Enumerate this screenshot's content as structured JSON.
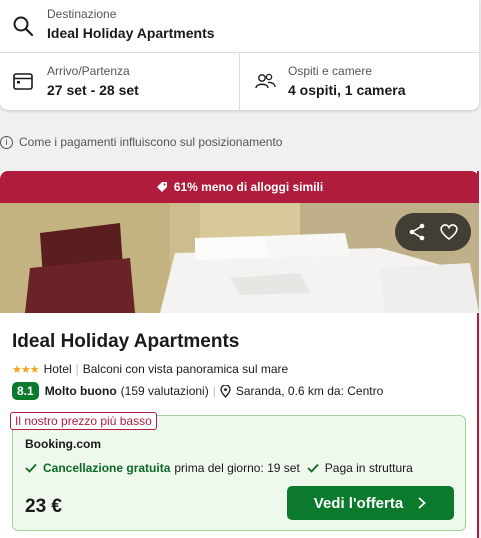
{
  "search": {
    "destination_label": "Destinazione",
    "destination_value": "Ideal Holiday Apartments",
    "dates_label": "Arrivo/Partenza",
    "dates_value": "27 set - 28 set",
    "guests_label": "Ospiti e camere",
    "guests_value": "4 ospiti, 1 camera"
  },
  "info_text": "Come i pagamenti influiscono sul posizionamento",
  "result": {
    "deal_banner": "61% meno di alloggi simili",
    "name": "Ideal Holiday Apartments",
    "stars": 3,
    "stars_glyph": "★★★",
    "type": "Hotel",
    "feature": "Balconi con vista panoramica sul mare",
    "rating_score": "8.1",
    "rating_word": "Molto buono",
    "rating_count": "(159 valutazioni)",
    "location": "Saranda, 0.6 km da: Centro",
    "offer": {
      "lowest_tag": "Il nostro prezzo più basso",
      "provider": "Booking.com",
      "cancel_strong": "Cancellazione gratuita",
      "cancel_rest": "prima del giorno: 19 set",
      "pay_info": "Paga in struttura",
      "price": "23 €",
      "cta_label": "Vedi l'offerta"
    }
  },
  "colors": {
    "brand_red": "#b01d3c",
    "rating_green": "#0c7a2d",
    "offer_bg": "#eef8ec",
    "star_yellow": "#f1a31a"
  },
  "icons": [
    "search-icon",
    "calendar-icon",
    "guests-icon",
    "info-icon",
    "tag-icon",
    "share-icon",
    "heart-icon",
    "pin-icon",
    "check-icon",
    "chevron-right-icon"
  ]
}
